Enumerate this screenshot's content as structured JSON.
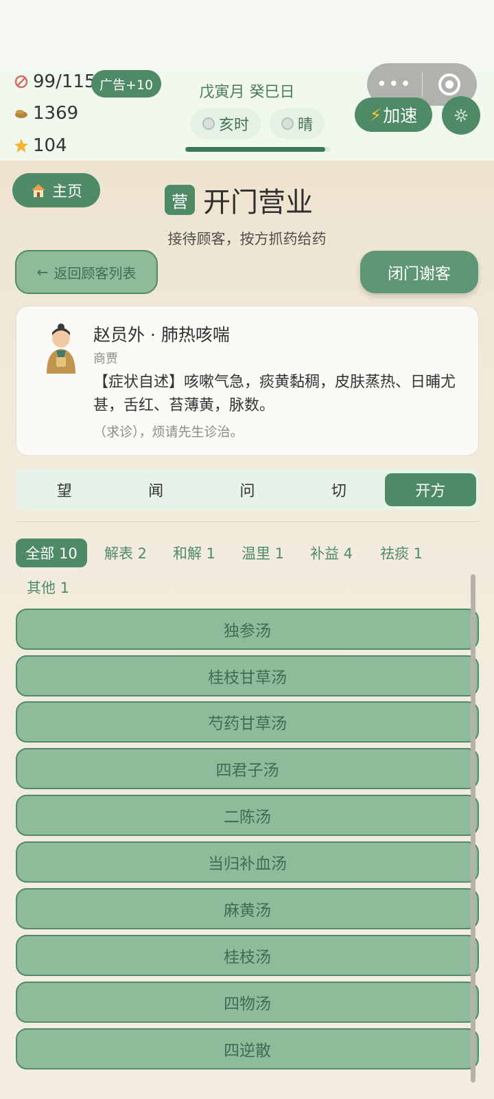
{
  "hud": {
    "energy": "99/115",
    "ad_button": "广告+10",
    "coins": "1369",
    "stars": "104",
    "date": "戊寅月 癸巳日",
    "time_label": "亥时",
    "weather_label": "晴",
    "day_progress": 0.96,
    "speed_button": "加速"
  },
  "header": {
    "home_button": "主页",
    "title_badge": "营",
    "title": "开门营业",
    "subtitle": "接待顾客，按方抓药给药",
    "back_button": "返回顾客列表",
    "close_button": "闭门谢客"
  },
  "patient": {
    "name": "赵员外 · 肺热咳喘",
    "occupation": "商贾",
    "symptoms": "【症状自述】咳嗽气急，痰黄黏稠，皮肤蒸热、日晡尤甚，舌红、苔薄黄，脉数。",
    "request": "（求诊），烦请先生诊治。"
  },
  "tabs": [
    "望",
    "闻",
    "问",
    "切",
    "开方"
  ],
  "active_tab": 4,
  "categories": [
    "全部 10",
    "解表 2",
    "和解 1",
    "温里 1",
    "补益 4",
    "祛痰 1",
    "其他 1"
  ],
  "active_category": 0,
  "prescriptions": [
    "独参汤",
    "桂枝甘草汤",
    "芍药甘草汤",
    "四君子汤",
    "二陈汤",
    "当归补血汤",
    "麻黄汤",
    "桂枝汤",
    "四物汤",
    "四逆散"
  ],
  "colors": {
    "accent": "#4f8a66",
    "item_bg": "#8fbb9b",
    "hud_bg": "#f1f8ee",
    "page_bg": "#efe6d2"
  }
}
